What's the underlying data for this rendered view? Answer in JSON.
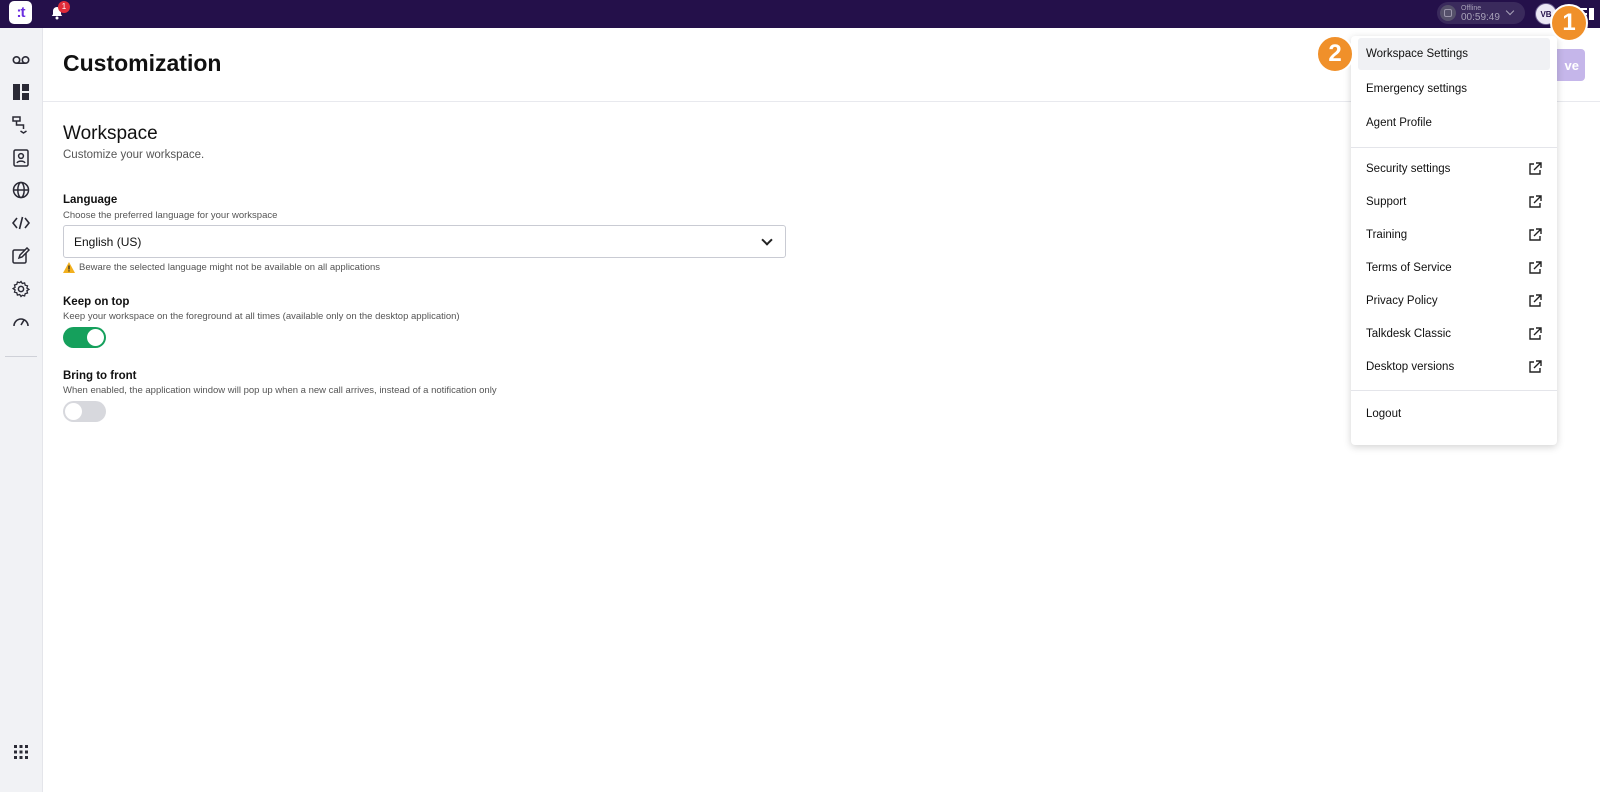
{
  "topbar": {
    "logo_text": ":t",
    "notification_count": "1",
    "status_label": "Offline",
    "status_time": "00:59:49",
    "avatar_initials": "VB"
  },
  "sidebar": {
    "icons": [
      "voicemail-icon",
      "dashboard-icon",
      "routing-icon",
      "contacts-icon",
      "globe-icon",
      "code-icon",
      "edit-icon",
      "settings-icon",
      "speedometer-icon",
      "apps-grid-icon"
    ]
  },
  "page": {
    "title": "Customization",
    "save_label": "ve"
  },
  "workspace": {
    "title": "Workspace",
    "subtitle": "Customize your workspace."
  },
  "language": {
    "label": "Language",
    "help": "Choose the preferred language for your workspace",
    "value": "English (US)",
    "warning": "Beware the selected language might not be available on all applications"
  },
  "keep_on_top": {
    "label": "Keep on top",
    "help": "Keep your workspace on the foreground at all times (available only on the desktop application)",
    "enabled": true
  },
  "bring_to_front": {
    "label": "Bring to front",
    "help": "When enabled, the application window will pop up when a new call arrives, instead of a notification only",
    "enabled": false
  },
  "menu": {
    "group1": [
      "Workspace Settings",
      "Emergency settings",
      "Agent Profile"
    ],
    "group2": [
      "Security settings",
      "Support",
      "Training",
      "Terms of Service",
      "Privacy Policy",
      "Talkdesk Classic",
      "Desktop versions"
    ],
    "logout": "Logout"
  },
  "annotations": {
    "step1": "1",
    "step2": "2"
  },
  "colors": {
    "topbar": "#24104a",
    "accent": "#6b2ee0",
    "toggle_on": "#15a05c",
    "step_badge": "#f0902a"
  }
}
